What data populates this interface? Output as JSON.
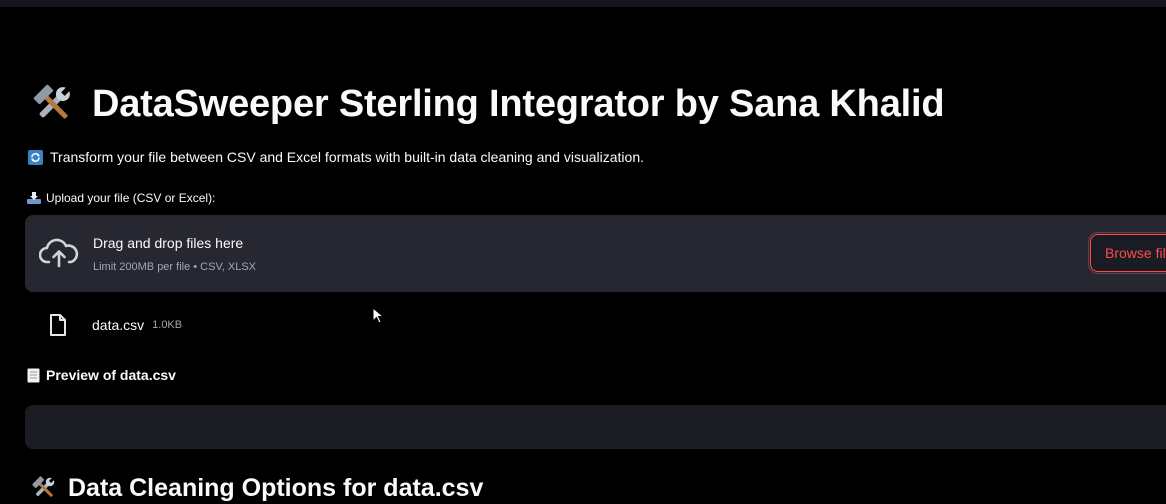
{
  "app": {
    "title": "DataSweeper Sterling Integrator by Sana Khalid",
    "title_icon": "hammer-and-wrench-icon",
    "description": "Transform your file between CSV and Excel formats with built-in data cleaning and visualization.",
    "description_icon": "refresh-icon"
  },
  "uploader": {
    "label": "Upload your file (CSV or Excel):",
    "label_icon": "inbox-tray-icon",
    "drop_text": "Drag and drop files here",
    "limit_text": "Limit 200MB per file • CSV, XLSX",
    "browse_label": "Browse files",
    "upload_icon": "cloud-upload-icon"
  },
  "uploaded_file": {
    "name": "data.csv",
    "size": "1.0KB",
    "icon": "file-icon"
  },
  "preview": {
    "label": "Preview of data.csv",
    "icon": "page-icon"
  },
  "cleaning": {
    "heading": "Data Cleaning Options for data.csv",
    "icon": "hammer-and-wrench-icon"
  },
  "colors": {
    "background": "#000000",
    "surface": "#262730",
    "accent": "#ff4b4b",
    "muted_text": "#a3a8b4"
  }
}
